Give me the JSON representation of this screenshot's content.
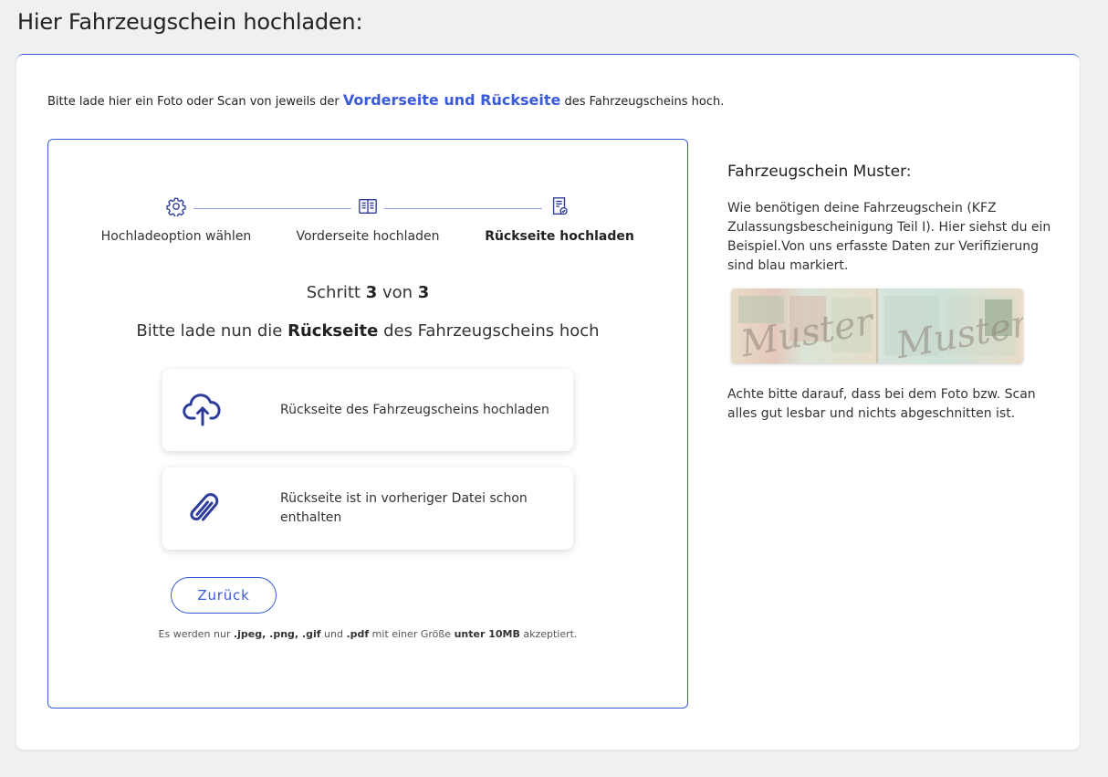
{
  "page": {
    "title": "Hier Fahrzeugschein hochladen:"
  },
  "intro": {
    "before": "Bitte lade hier ein Foto oder Scan von jeweils der ",
    "highlight": "Vorderseite und Rückseite",
    "after": " des Fahrzeugscheins hoch."
  },
  "stepper": {
    "steps": [
      {
        "label": "Hochladeoption wählen",
        "icon": "gear-icon",
        "active": false
      },
      {
        "label": "Vorderseite hochladen",
        "icon": "open-book-icon",
        "active": false
      },
      {
        "label": "Rückseite hochladen",
        "icon": "document-check-icon",
        "active": true
      }
    ],
    "count": {
      "prefix": "Schritt ",
      "current": "3",
      "middle": " von ",
      "total": "3"
    }
  },
  "instruction": {
    "before": "Bitte lade nun die ",
    "bold": "Rückseite",
    "after": " des Fahrzeugscheins hoch"
  },
  "options": [
    {
      "label": "Rückseite des Fahrzeugscheins hochladen",
      "icon": "cloud-upload-icon"
    },
    {
      "label": "Rückseite ist in vorheriger Datei schon enthalten",
      "icon": "paperclip-icon"
    }
  ],
  "back_button": {
    "label": "Zurück"
  },
  "note": {
    "t1": "Es werden nur ",
    "b1": ".jpeg, .png, .gif",
    "t2": " und ",
    "b2": ".pdf",
    "t3": " mit einer Größe ",
    "b3": "unter 10MB",
    "t4": " akzeptiert."
  },
  "sidebar": {
    "title": "Fahrzeugschein Muster:",
    "text1": "Wie benötigen deine Fahrzeugschein (KFZ Zulassungsbescheinigung Teil I). Hier siehst du ein Beispiel.Von uns erfasste Daten zur Verifizierung sind blau markiert.",
    "sample_watermark": "Muster",
    "text2": "Achte bitte darauf, dass bei dem Foto bzw. Scan alles gut lesbar und nichts abgeschnitten ist."
  },
  "colors": {
    "accent": "#3a5bd9",
    "icon": "#2e3d9c",
    "background": "#f0f0f0"
  }
}
